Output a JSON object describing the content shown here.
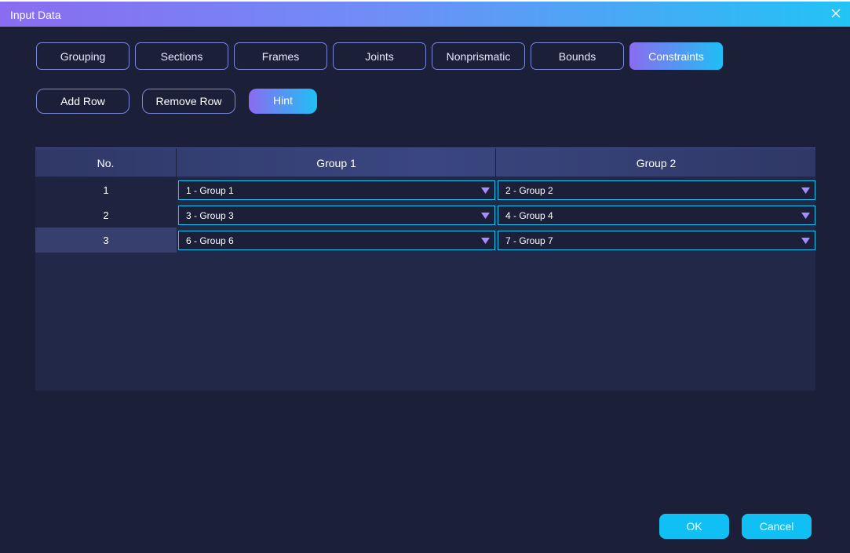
{
  "window": {
    "title": "Input Data"
  },
  "tabs": [
    {
      "label": "Grouping"
    },
    {
      "label": "Sections"
    },
    {
      "label": "Frames"
    },
    {
      "label": "Joints"
    },
    {
      "label": "Nonprismatic"
    },
    {
      "label": "Bounds"
    },
    {
      "label": "Constraints",
      "active": true
    }
  ],
  "actions": {
    "add_row": "Add Row",
    "remove_row": "Remove Row",
    "hint": "Hint"
  },
  "table": {
    "headers": [
      "No.",
      "Group 1",
      "Group 2"
    ],
    "rows": [
      {
        "no": "1",
        "group1": "1 - Group 1",
        "group2": "2 - Group 2"
      },
      {
        "no": "2",
        "group1": "3 - Group 3",
        "group2": "4 - Group 4"
      },
      {
        "no": "3",
        "group1": "6 - Group 6",
        "group2": "7 - Group 7"
      }
    ],
    "selected_row": "3"
  },
  "footer": {
    "ok": "OK",
    "cancel": "Cancel"
  },
  "colors": {
    "background": "#1b1f38",
    "accent_start": "#8a6cf0",
    "accent_end": "#1fbff5",
    "select_border": "#18c4f2",
    "dropdown_arrow": "#a98cff"
  }
}
